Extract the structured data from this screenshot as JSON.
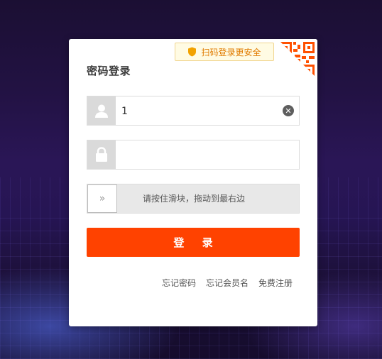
{
  "login": {
    "title": "密码登录",
    "qr_tip": "扫码登录更安全",
    "username_value": "1",
    "password_value": "",
    "slider_text": "请按住滑块，拖动到最右边",
    "submit_label": "登 录",
    "links": [
      "忘记密码",
      "忘记会员名",
      "免费注册"
    ]
  },
  "colors": {
    "accent": "#ff4200",
    "tip_text": "#e07b00",
    "qr": "#ff5000"
  },
  "icons": [
    "shield-icon",
    "qr-code-icon",
    "user-icon",
    "clear-icon",
    "lock-icon",
    "double-chevron-right-icon"
  ]
}
